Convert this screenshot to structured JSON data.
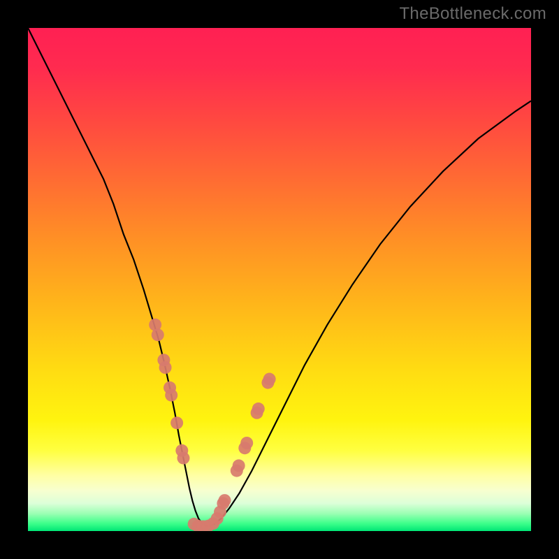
{
  "watermark": "TheBottleneck.com",
  "chart_data": {
    "type": "line",
    "title": "",
    "xlabel": "",
    "ylabel": "",
    "xlim": [
      0,
      100
    ],
    "ylim": [
      0,
      100
    ],
    "background_gradient_stops": [
      {
        "offset": 0.0,
        "color": "#ff2053"
      },
      {
        "offset": 0.08,
        "color": "#ff2b4f"
      },
      {
        "offset": 0.18,
        "color": "#ff4741"
      },
      {
        "offset": 0.3,
        "color": "#ff6b33"
      },
      {
        "offset": 0.42,
        "color": "#ff9025"
      },
      {
        "offset": 0.55,
        "color": "#ffb61a"
      },
      {
        "offset": 0.68,
        "color": "#ffdc12"
      },
      {
        "offset": 0.78,
        "color": "#fff40f"
      },
      {
        "offset": 0.84,
        "color": "#ffff40"
      },
      {
        "offset": 0.89,
        "color": "#ffffa5"
      },
      {
        "offset": 0.92,
        "color": "#f7ffd0"
      },
      {
        "offset": 0.945,
        "color": "#dcffd8"
      },
      {
        "offset": 0.965,
        "color": "#9cffb4"
      },
      {
        "offset": 0.985,
        "color": "#3dff8a"
      },
      {
        "offset": 1.0,
        "color": "#00e676"
      }
    ],
    "series": [
      {
        "name": "bottleneck-curve",
        "x": [
          0,
          3,
          6,
          9,
          12,
          15,
          17,
          19,
          21,
          23,
          24.5,
          26,
          27.2,
          28.3,
          29.2,
          30.0,
          30.8,
          31.5,
          32.1,
          32.7,
          33.3,
          33.9,
          34.6,
          35.3,
          36.2,
          37.2,
          38.4,
          40.0,
          42.0,
          44.5,
          47.5,
          51.0,
          55.0,
          59.5,
          64.5,
          70.0,
          76.0,
          82.5,
          89.5,
          97.0,
          100.0
        ],
        "y": [
          100,
          94,
          88,
          82,
          76,
          70,
          65,
          59,
          54,
          48,
          43,
          38,
          33,
          28,
          23.5,
          19,
          15,
          11.5,
          8.5,
          6.0,
          4.0,
          2.5,
          1.5,
          1.0,
          1.0,
          1.5,
          2.5,
          4.5,
          7.5,
          12,
          18,
          25,
          33,
          41,
          49,
          57,
          64.5,
          71.5,
          78,
          83.5,
          85.5
        ]
      }
    ],
    "markers": [
      {
        "name": "left-cluster",
        "color": "#d87b6e",
        "points": [
          [
            25.3,
            41.0
          ],
          [
            25.8,
            39.0
          ],
          [
            27.0,
            34.0
          ],
          [
            27.3,
            32.5
          ],
          [
            28.2,
            28.5
          ],
          [
            28.5,
            27.0
          ],
          [
            29.6,
            21.5
          ],
          [
            30.6,
            16.0
          ],
          [
            30.9,
            14.5
          ]
        ]
      },
      {
        "name": "right-cluster",
        "color": "#d87b6e",
        "points": [
          [
            38.8,
            5.5
          ],
          [
            39.1,
            6.1
          ],
          [
            41.5,
            12.0
          ],
          [
            41.9,
            13.0
          ],
          [
            43.1,
            16.5
          ],
          [
            43.5,
            17.5
          ],
          [
            45.5,
            23.5
          ],
          [
            45.8,
            24.3
          ],
          [
            47.7,
            29.5
          ],
          [
            48.0,
            30.2
          ]
        ]
      },
      {
        "name": "bottom-cluster",
        "color": "#d87b6e",
        "points": [
          [
            33.0,
            1.4
          ],
          [
            33.8,
            1.0
          ],
          [
            34.8,
            0.9
          ],
          [
            35.8,
            1.0
          ],
          [
            36.8,
            1.5
          ],
          [
            37.6,
            2.5
          ],
          [
            38.2,
            3.8
          ]
        ]
      }
    ]
  }
}
